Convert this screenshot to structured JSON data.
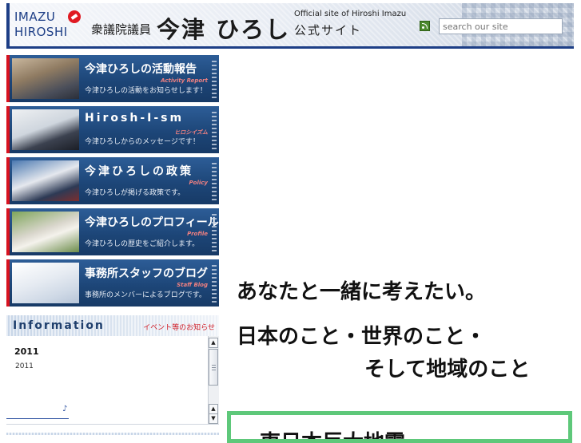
{
  "header": {
    "logo_line1": "IMAZU",
    "logo_line2": "HIROSHI",
    "role": "衆議院議員",
    "name": "今津 ひろし",
    "official_en": "Official site of Hiroshi Imazu",
    "official_ja": "公式サイト",
    "search_placeholder": "search our site"
  },
  "banners": [
    {
      "title": "今津ひろしの活動報告",
      "subtitle": "Activity Report",
      "desc": "今津ひろしの活動をお知らせします！"
    },
    {
      "title": "Hirosh-I-sm",
      "subtitle": "ヒロシイズム",
      "desc": "今津ひろしからのメッセージです！"
    },
    {
      "title": "今津ひろしの政策",
      "subtitle": "Policy",
      "desc": "今津ひろしが掲げる政策です。"
    },
    {
      "title": "今津ひろしのプロフィール",
      "subtitle": "Profile",
      "desc": "今津ひろしの歴史をご紹介します。"
    },
    {
      "title": "事務所スタッフのブログ",
      "subtitle": "Staff Blog",
      "desc": "事務所のメンバーによるブログです。"
    }
  ],
  "information": {
    "title": "Information",
    "subtitle": "イベント等のお知らせ",
    "year": "2011",
    "entry": "2011",
    "link_icon": "♪"
  },
  "main": {
    "copy_line1": "あなたと一緒に考えたい。",
    "copy_line2": "日本のこと・世界のこと・",
    "copy_line3": "そして地域のこと",
    "news_title": "東日本巨大地震"
  },
  "icons": [
    "imazu-logo-icon",
    "rss-icon",
    "scroll-up-icon",
    "scroll-down-icon",
    "music-note-icon"
  ],
  "colors": {
    "brand_blue": "#1d3e86",
    "banner_accent": "#d8121f",
    "news_border": "#5ec87a"
  }
}
